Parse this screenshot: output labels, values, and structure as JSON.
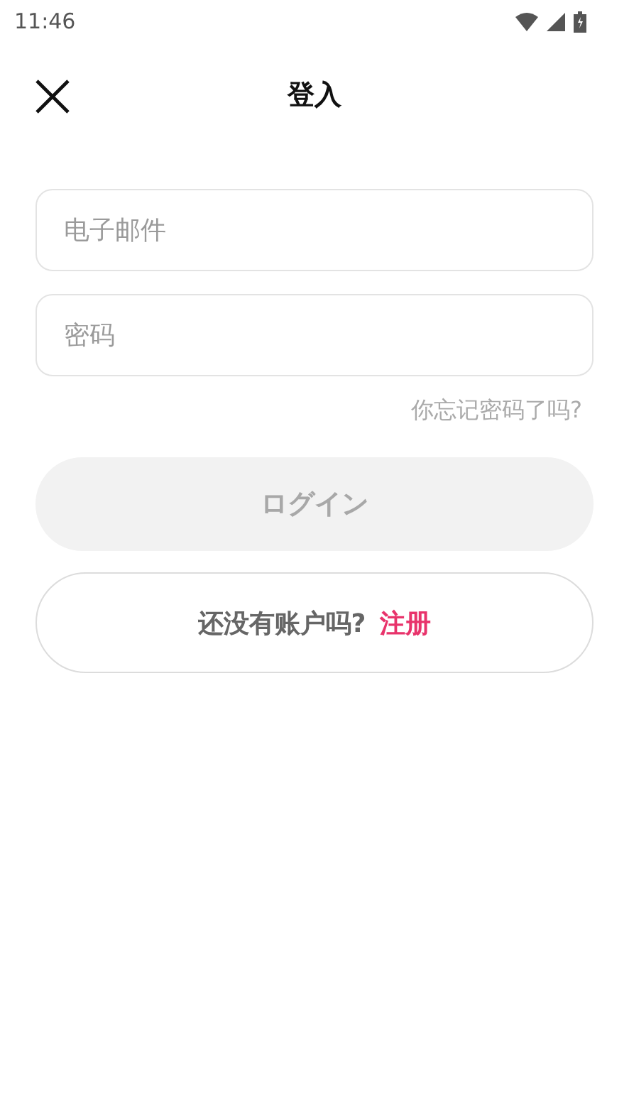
{
  "status_bar": {
    "time": "11:46"
  },
  "header": {
    "title": "登入"
  },
  "fields": [
    {
      "placeholder": "电子邮件"
    },
    {
      "placeholder": "密码"
    }
  ],
  "forgot_link": "你忘记密码了吗?",
  "login_button": {
    "label": "ログイン",
    "disabled": true
  },
  "signup": {
    "prompt": "还没有账户吗?",
    "link": "注册"
  }
}
